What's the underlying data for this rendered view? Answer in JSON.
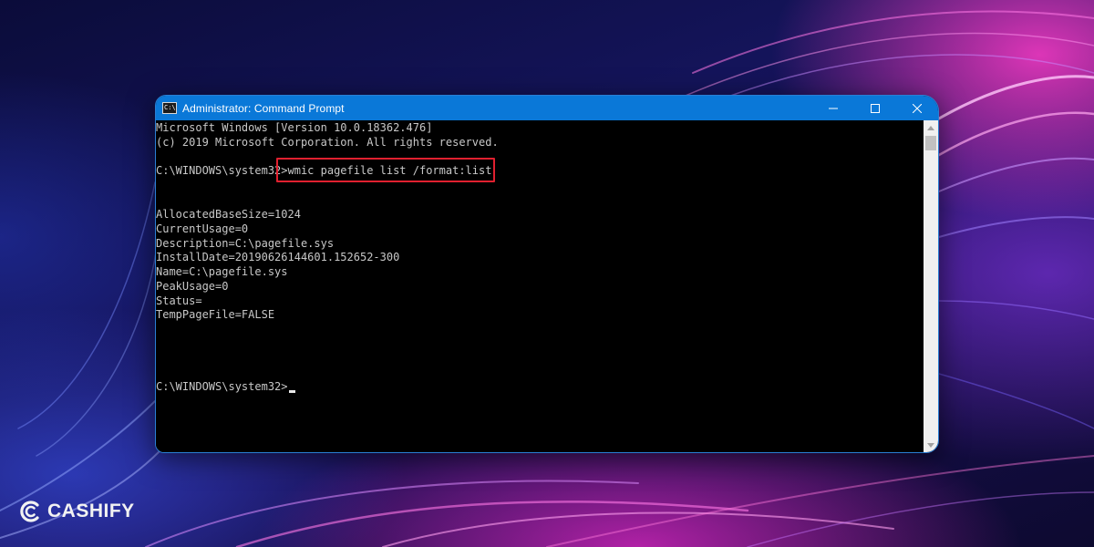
{
  "window": {
    "title": "Administrator: Command Prompt",
    "icon": "cmd-icon",
    "controls": {
      "minimize": "minimize-icon",
      "maximize": "maximize-icon",
      "close": "close-icon"
    }
  },
  "console": {
    "lines": [
      "Microsoft Windows [Version 10.0.18362.476]",
      "(c) 2019 Microsoft Corporation. All rights reserved.",
      "",
      "C:\\WINDOWS\\system32>wmic pagefile list /format:list",
      "",
      "",
      "AllocatedBaseSize=1024",
      "CurrentUsage=0",
      "Description=C:\\pagefile.sys",
      "InstallDate=20190626144601.152652-300",
      "Name=C:\\pagefile.sys",
      "PeakUsage=0",
      "Status=",
      "TempPageFile=FALSE",
      "",
      "",
      "",
      "",
      "C:\\WINDOWS\\system32>"
    ],
    "highlight_color": "#e0202f"
  },
  "brand": {
    "logo_text": "CASHIFY"
  },
  "colors": {
    "titlebar": "#0a78d8",
    "console_bg": "#000000",
    "console_text": "#c8c8c8"
  }
}
